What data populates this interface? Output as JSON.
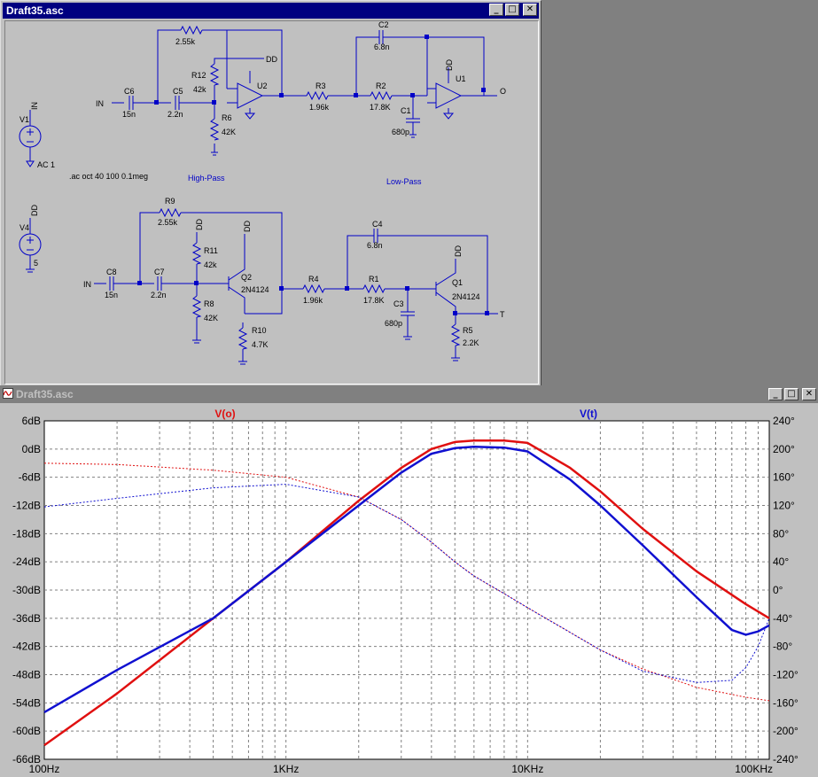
{
  "schematic_window": {
    "title": "Draft35.asc",
    "buttons": {
      "minimize": "_",
      "maximize": "□",
      "close": "✕"
    },
    "labels": {
      "r_fb1_name": "",
      "r_fb1_value": "2.55k",
      "c6_name": "C6",
      "c6_value": "15n",
      "c5_name": "C5",
      "c5_value": "2.2n",
      "r12_name": "R12",
      "r12_value": "42k",
      "r6_name": "R6",
      "r6_value": "42K",
      "u2_name": "U2",
      "dd_u2": "DD",
      "in1": "IN",
      "r3_name": "R3",
      "r3_value": "1.96k",
      "r2_name": "R2",
      "r2_value": "17.8K",
      "c2_name": "C2",
      "c2_value": "6.8n",
      "c1_name": "C1",
      "c1_value": "680p",
      "u1_name": "U1",
      "dd_u1": "DD",
      "out_o": "O",
      "v1_name": "V1",
      "v1_in": "IN",
      "v1_value": "AC 1",
      "directive": ".ac oct 40 100 0.1meg",
      "high_pass": "High-Pass",
      "low_pass": "Low-Pass",
      "v4_name": "V4",
      "v4_dd": "DD",
      "v4_value": "5",
      "r9_name": "R9",
      "r9_value": "2.55k",
      "r11_name": "R11",
      "r11_value": "42k",
      "dd_r11": "DD",
      "q2_name": "Q2",
      "q2_value": "2N4124",
      "dd_q2": "DD",
      "c8_name": "C8",
      "c8_value": "15n",
      "c7_name": "C7",
      "c7_value": "2.2n",
      "in2": "IN",
      "r8_name": "R8",
      "r8_value": "42K",
      "r10_name": "R10",
      "r10_value": "4.7K",
      "r4_name": "R4",
      "r4_value": "1.96k",
      "r1_name": "R1",
      "r1_value": "17.8K",
      "c4_name": "C4",
      "c4_value": "6.8n",
      "c3_name": "C3",
      "c3_value": "680p",
      "q1_name": "Q1",
      "q1_value": "2N4124",
      "dd_q1": "DD",
      "r5_name": "R5",
      "r5_value": "2.2K",
      "out_t": "T"
    }
  },
  "plot_window": {
    "title": "Draft35.asc",
    "buttons": {
      "minimize": "_",
      "maximize": "□",
      "close": "✕"
    }
  },
  "chart_data": {
    "type": "line",
    "x_scale": "log",
    "xlim": [
      100,
      100000
    ],
    "x_ticks": [
      100,
      1000,
      10000,
      100000
    ],
    "x_tick_labels": [
      "100Hz",
      "1KHz",
      "10KHz",
      "100KHz"
    ],
    "ylim": [
      -66,
      6
    ],
    "y_ticks": [
      6,
      0,
      -6,
      -12,
      -18,
      -24,
      -30,
      -36,
      -42,
      -48,
      -54,
      -60,
      -66
    ],
    "y_tick_labels": [
      "6dB",
      "0dB",
      "-6dB",
      "-12dB",
      "-18dB",
      "-24dB",
      "-30dB",
      "-36dB",
      "-42dB",
      "-48dB",
      "-54dB",
      "-60dB",
      "-66dB"
    ],
    "y2lim": [
      -240,
      240
    ],
    "y2_ticks": [
      240,
      200,
      160,
      120,
      80,
      40,
      0,
      -40,
      -80,
      -120,
      -160,
      -200,
      -240
    ],
    "y2_tick_labels": [
      "240°",
      "200°",
      "160°",
      "120°",
      "80°",
      "40°",
      "0°",
      "-40°",
      "-80°",
      "-120°",
      "-160°",
      "-200°",
      "-240°"
    ],
    "grid": true,
    "series": [
      {
        "name": "V(o)",
        "color": "#e01010",
        "freq": [
          100,
          200,
          500,
          1000,
          2000,
          3000,
          4000,
          5000,
          6000,
          8000,
          10000,
          15000,
          20000,
          30000,
          50000,
          80000,
          100000
        ],
        "magnitude_db": [
          -63,
          -52,
          -36,
          -24,
          -11,
          -4,
          0,
          1.5,
          1.8,
          1.8,
          1.3,
          -4,
          -9,
          -17,
          -26,
          -33,
          -36
        ],
        "phase_deg": [
          180,
          178,
          170,
          160,
          132,
          100,
          68,
          40,
          20,
          -5,
          -25,
          -60,
          -85,
          -112,
          -138,
          -152,
          -157
        ]
      },
      {
        "name": "V(t)",
        "color": "#1010d0",
        "freq": [
          100,
          200,
          500,
          1000,
          2000,
          3000,
          4000,
          5000,
          6000,
          8000,
          10000,
          15000,
          20000,
          30000,
          50000,
          70000,
          80000,
          90000,
          100000
        ],
        "magnitude_db": [
          -56,
          -47,
          -36,
          -24,
          -12,
          -5,
          -1,
          0.2,
          0.5,
          0.3,
          -0.5,
          -6.5,
          -12,
          -20.5,
          -31.5,
          -38.5,
          -39.5,
          -38.8,
          -37.5
        ],
        "phase_deg": [
          118,
          130,
          145,
          150,
          132,
          100,
          68,
          40,
          20,
          -5,
          -25,
          -60,
          -85,
          -115,
          -131,
          -128,
          -110,
          -80,
          -40
        ]
      }
    ]
  }
}
